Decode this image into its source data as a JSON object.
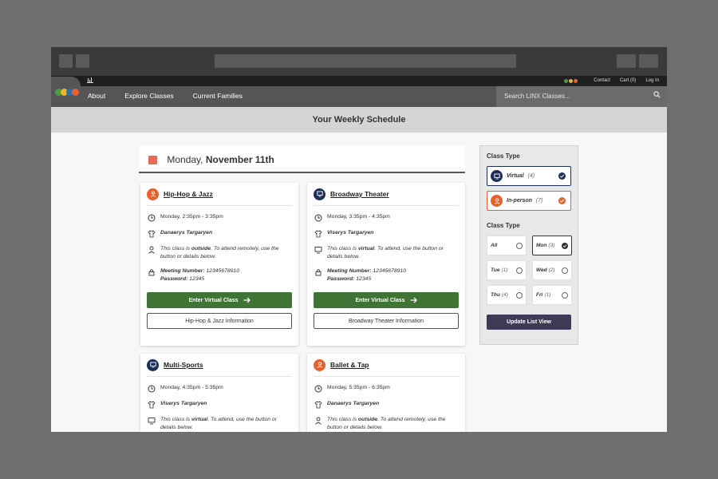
{
  "utility": {
    "contact": "Contact",
    "cart": "Cart (0)",
    "login": "Log In"
  },
  "nav": {
    "about": "About",
    "explore": "Explore Classes",
    "families": "Current Families",
    "search_placeholder": "Search LINX Classes..."
  },
  "page": {
    "title": "Your Weekly Schedule"
  },
  "day": {
    "weekday": "Monday,",
    "date": "November 11th"
  },
  "cards": [
    {
      "title": "Hip-Hop & Jazz",
      "type": "in-person",
      "time": "Monday, 2:35pm - 3:35pm",
      "instructor": "Danaerys Targaryen",
      "location_pre": "This class is ",
      "location_em": "outside",
      "location_post": ". To attend remotely, use the button or details below.",
      "meeting_label": "Meeting Number:",
      "meeting": "12345678910",
      "password_label": "Password:",
      "password": "12345",
      "enter": "Enter Virtual Class",
      "info": "Hip-Hop & Jazz Information"
    },
    {
      "title": "Broadway Theater",
      "type": "virtual",
      "time": "Monday, 3:35pm - 4:35pm",
      "instructor": "Viserys Targaryen",
      "location_pre": "This class is ",
      "location_em": "virtual",
      "location_post": ". To attend, use the button or details below.",
      "meeting_label": "Meeting Number:",
      "meeting": "12345678910",
      "password_label": "Password:",
      "password": "12345",
      "enter": "Enter Virtual Class",
      "info": "Broadway Theater Information"
    },
    {
      "title": "Multi-Sports",
      "type": "virtual",
      "time": "Monday, 4:35pm - 5:35pm",
      "instructor": "Viserys Targaryen",
      "location_pre": "This class is ",
      "location_em": "virtual",
      "location_post": ". To attend, use the button or details below."
    },
    {
      "title": "Ballet & Tap",
      "type": "in-person",
      "time": "Monday, 5:35pm - 6:35pm",
      "instructor": "Danaerys Targaryen",
      "location_pre": "This class is ",
      "location_em": "outside",
      "location_post": ". To attend remotely, use the button or details below."
    }
  ],
  "filters": {
    "class_type_title": "Class Type",
    "virtual": {
      "label": "Virtual",
      "count": "(4)"
    },
    "inperson": {
      "label": "In-person",
      "count": "(7)"
    },
    "day_title": "Class Type",
    "days": [
      {
        "label": "All",
        "count": ""
      },
      {
        "label": "Mon",
        "count": "(3)"
      },
      {
        "label": "Tue",
        "count": "(1)"
      },
      {
        "label": "Wed",
        "count": "(2)"
      },
      {
        "label": "Thu",
        "count": "(4)"
      },
      {
        "label": "Fri",
        "count": "(1)"
      }
    ],
    "update": "Update List View"
  },
  "colors": {
    "orange": "#e8612c",
    "navy": "#1c2f5a",
    "green": "#3e7535",
    "dark_button": "#3d3a55"
  }
}
